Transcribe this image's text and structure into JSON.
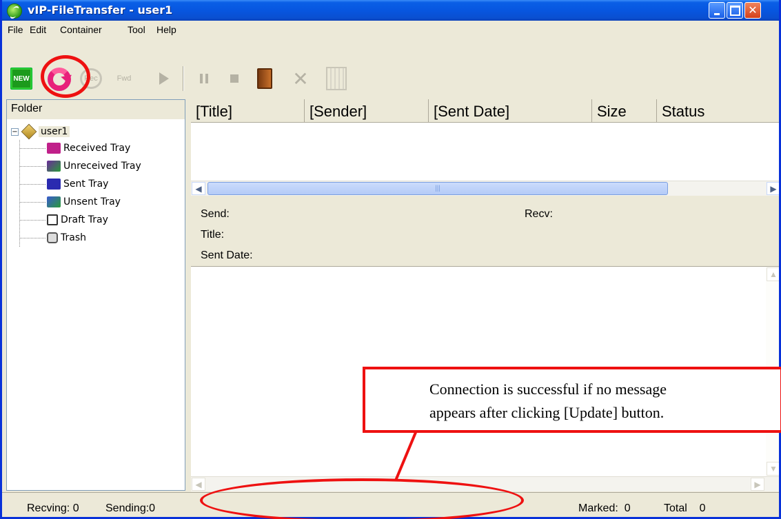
{
  "window": {
    "title": "vIP-FileTransfer - user1",
    "controls": {
      "minimize": "minimize",
      "maximize": "maximize",
      "close": "✕"
    }
  },
  "menu": [
    "File",
    "Edit",
    "Container",
    "Tool",
    "Help"
  ],
  "toolbar": {
    "new_label": "NEW",
    "icons": [
      "new-icon",
      "update-icon",
      "receive-icon",
      "forward-icon",
      "play-icon",
      "pause-icon",
      "stop-icon",
      "exit-door-icon",
      "delete-icon",
      "building-icon"
    ],
    "receive_label": "Rec",
    "forward_label": "Fwd"
  },
  "folder_pane": {
    "title": "Folder",
    "root": "user1",
    "items": [
      {
        "label": "Received Tray",
        "color": "#c0208a"
      },
      {
        "label": "Unreceived Tray",
        "color": "#6a2a9a"
      },
      {
        "label": "Sent Tray",
        "color": "#2a2ab0"
      },
      {
        "label": "Unsent Tray",
        "color": "#3a5ad0"
      },
      {
        "label": "Draft Tray",
        "color": "#333333"
      },
      {
        "label": "Trash",
        "color": "#555555"
      }
    ]
  },
  "list": {
    "columns": [
      "[Title]",
      "[Sender]",
      "[Sent Date]",
      "Size",
      "Status"
    ],
    "rows": []
  },
  "detail": {
    "send_label": "Send:",
    "recv_label": "Recv:",
    "title_label": "Title:",
    "sent_date_label": "Sent Date:"
  },
  "annotation": {
    "line1": "Connection is successful if no message",
    "line2": "appears after clicking [Update] button.",
    "color": "#ee1111"
  },
  "status": {
    "recving": "Recving: 0",
    "sending": "Sending:0",
    "marked": "Marked:  0",
    "total": "Total    0"
  }
}
